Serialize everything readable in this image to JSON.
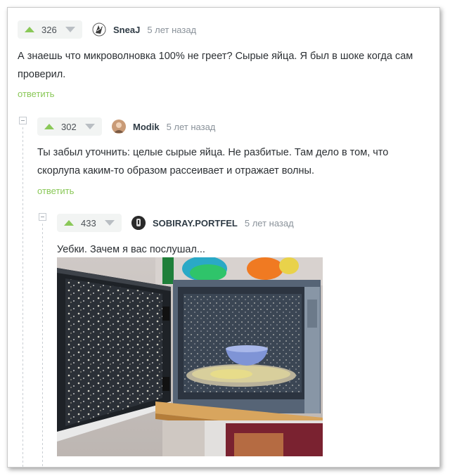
{
  "comments": [
    {
      "score": "326",
      "author": "SneaJ",
      "time": "5 лет назад",
      "text": "А знаешь что микроволновка 100% не греет? Сырые яйца. Я был в шоке когда сам проверил.",
      "reply_label": "ответить",
      "avatar_icon": "sneaj-avatar-icon"
    },
    {
      "score": "302",
      "author": "Modik",
      "time": "5 лет назад",
      "text": "Ты забыл уточнить: целые сырые яйца. Не разбитые. Там дело в том, что скорлупа каким-то образом рассеивает и отражает волны.",
      "reply_label": "ответить",
      "avatar_icon": "modik-avatar-icon"
    },
    {
      "score": "433",
      "author": "SOBIRAY.PORTFEL",
      "time": "5 лет назад",
      "text": "Уебки. Зачем я вас послушал...",
      "avatar_icon": "sobiray-avatar-icon"
    }
  ],
  "colors": {
    "accent_green": "#8ac858",
    "vote_bg": "#f2f4f3",
    "text": "#2b2f33",
    "muted": "#8a929a"
  }
}
